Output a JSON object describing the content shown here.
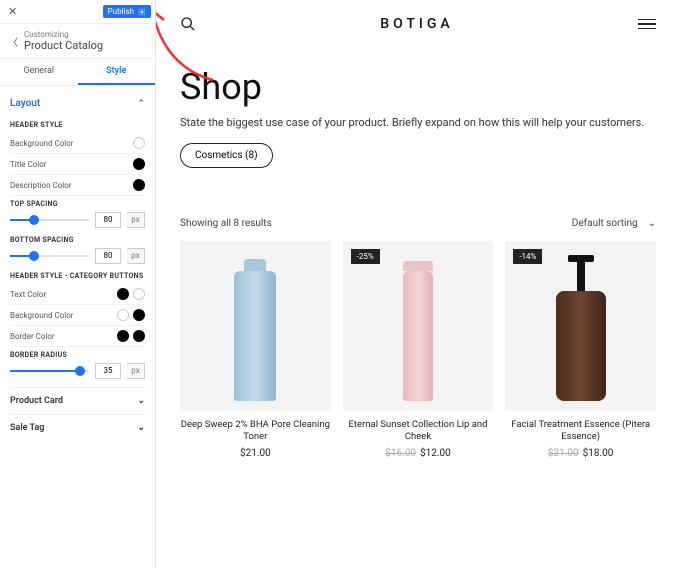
{
  "sidebar": {
    "publish_label": "Publish",
    "crumb_sub": "Customizing",
    "crumb_title": "Product Catalog",
    "tabs": {
      "general": "General",
      "style": "Style"
    },
    "layout": {
      "label": "Layout",
      "header_style_title": "HEADER STYLE",
      "bg_color": "Background Color",
      "title_color": "Title Color",
      "desc_color": "Description Color",
      "top_spacing_title": "TOP SPACING",
      "top_spacing_value": "80",
      "top_spacing_unit": "px",
      "bottom_spacing_title": "BOTTOM SPACING",
      "bottom_spacing_value": "80",
      "bottom_spacing_unit": "px",
      "cat_buttons_title": "HEADER STYLE - CATEGORY BUTTONS",
      "text_color": "Text Color",
      "bg_color2": "Background Color",
      "border_color": "Border Color",
      "border_radius_title": "BORDER RADIUS",
      "border_radius_value": "35",
      "border_radius_unit": "px"
    },
    "collapsed": {
      "product_card": "Product Card",
      "sale_tag": "Sale Tag"
    }
  },
  "preview": {
    "brand": "BOTIGA",
    "heading": "Shop",
    "desc": "State the biggest use case of your product. Briefly expand on how this will help your customers.",
    "chip": "Cosmetics (8)",
    "results_text": "Showing all 8 results",
    "sort_label": "Default sorting",
    "products": [
      {
        "title": "Deep Sweep 2% BHA Pore Cleaning Toner",
        "price": "$21.00"
      },
      {
        "badge": "-25%",
        "title": "Eternal Sunset Collection Lip and Cheek",
        "old": "$16.00",
        "price": "$12.00"
      },
      {
        "badge": "-14%",
        "title": "Facial Treatment Essence (Pitera Essence)",
        "old": "$21.00",
        "price": "$18.00"
      }
    ]
  }
}
